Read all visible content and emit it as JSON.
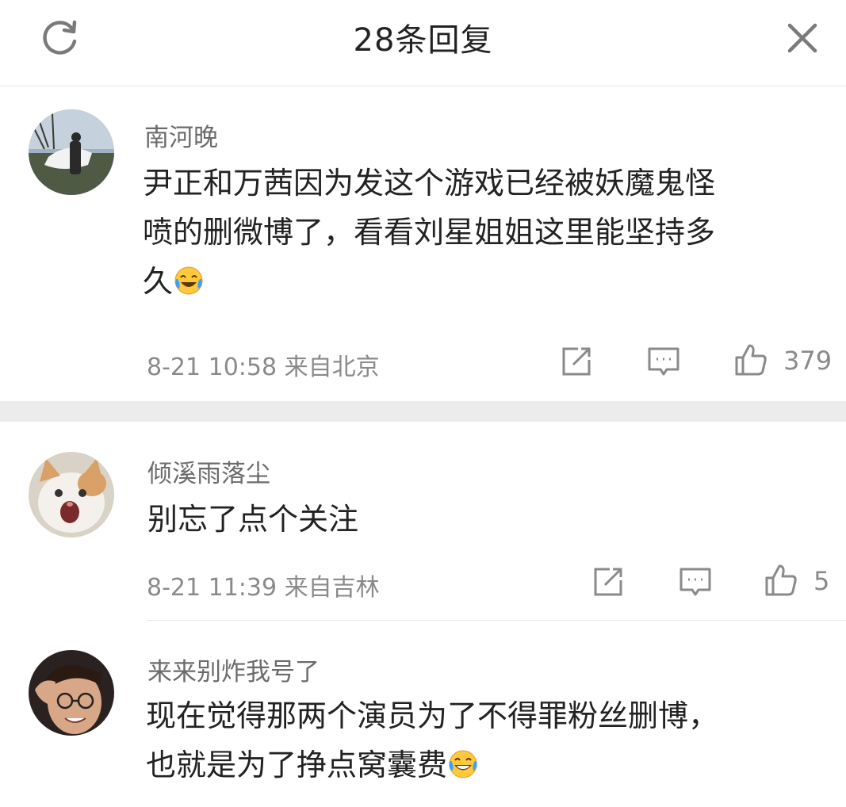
{
  "header": {
    "title": "28条回复",
    "refresh_icon": "refresh-icon",
    "close_icon": "close-icon"
  },
  "comments": [
    {
      "username": "南河晚",
      "lines": [
        "尹正和万茜因为发这个游戏已经被妖魔鬼怪",
        "喷的删微博了，看看刘星姐姐这里能坚持多",
        "久"
      ],
      "emoji": "laughing-tears-emoji",
      "date": "8-21 10:58",
      "location": "来自北京",
      "likes": "379",
      "avatar": "person-in-field-avatar"
    },
    {
      "username": "倾溪雨落尘",
      "lines": [
        "别忘了点个关注"
      ],
      "date": "8-21 11:39",
      "location": "来自吉林",
      "likes": "5",
      "avatar": "surprised-cat-avatar"
    },
    {
      "username": "来来别炸我号了",
      "lines": [
        "现在觉得那两个演员为了不得罪粉丝删博，",
        "也就是为了挣点窝囊费"
      ],
      "emoji": "grinning-tears-emoji",
      "avatar": "man-with-glasses-avatar"
    }
  ],
  "colors": {
    "text_primary": "#222222",
    "text_secondary": "#8a8a8a",
    "username": "#6b6b6b",
    "section_gap": "#ececec"
  }
}
